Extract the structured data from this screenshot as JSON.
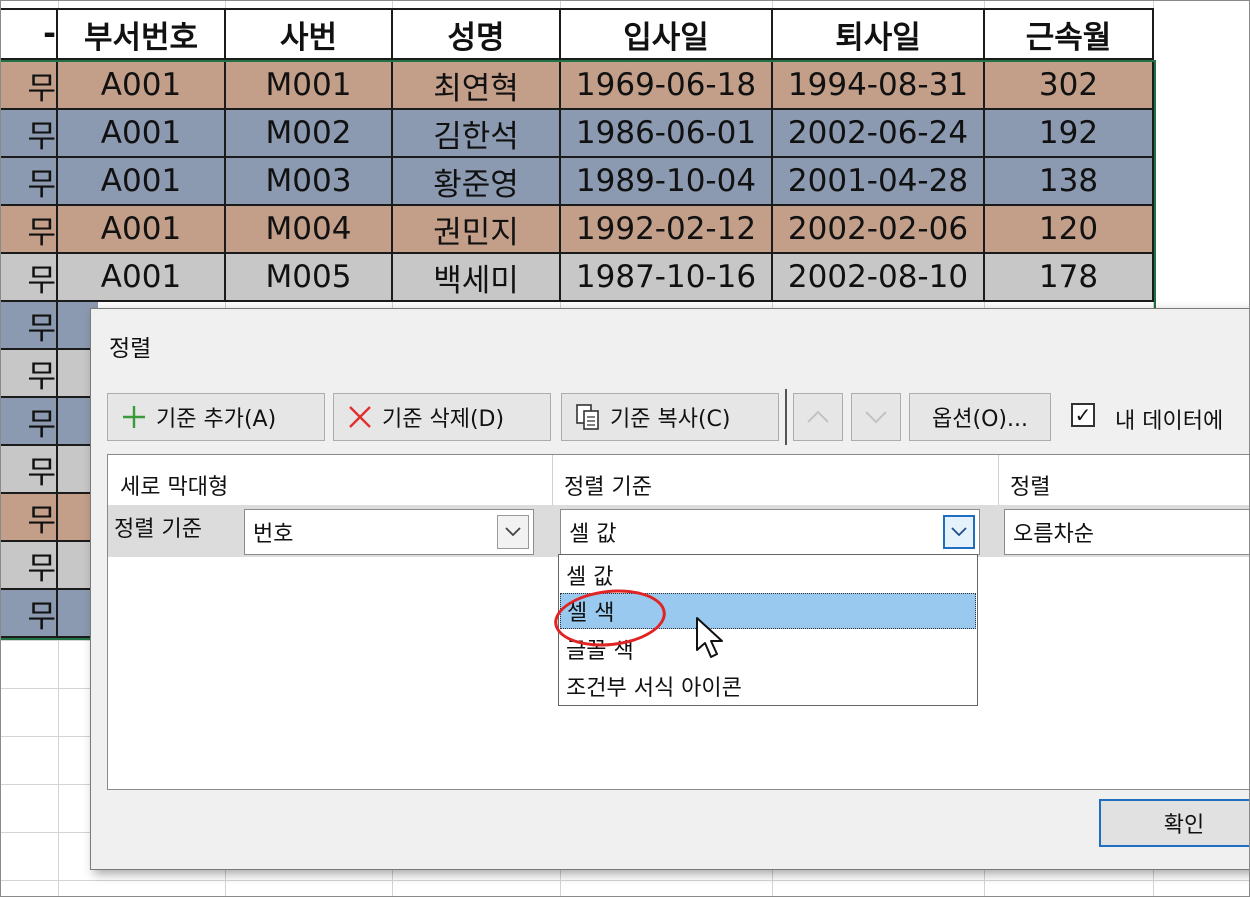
{
  "spreadsheet": {
    "headers": [
      "부서번호",
      "사번",
      "성명",
      "입사일",
      "퇴사일",
      "근속월"
    ],
    "partial_header": "-",
    "partial_cell": "무",
    "rows": [
      {
        "dept": "A001",
        "emp": "M001",
        "name": "최연혁",
        "hire": "1969-06-18",
        "leave": "1994-08-31",
        "months": "302",
        "color": "#c39f8a"
      },
      {
        "dept": "A001",
        "emp": "M002",
        "name": "김한석",
        "hire": "1986-06-01",
        "leave": "2002-06-24",
        "months": "192",
        "color": "#8b9ab1"
      },
      {
        "dept": "A001",
        "emp": "M003",
        "name": "황준영",
        "hire": "1989-10-04",
        "leave": "2001-04-28",
        "months": "138",
        "color": "#8b9ab1"
      },
      {
        "dept": "A001",
        "emp": "M004",
        "name": "권민지",
        "hire": "1992-02-12",
        "leave": "2002-02-06",
        "months": "120",
        "color": "#c39f8a"
      },
      {
        "dept": "A001",
        "emp": "M005",
        "name": "백세미",
        "hire": "1987-10-16",
        "leave": "2002-08-10",
        "months": "178",
        "color": "#c7c7c7"
      }
    ],
    "left_column_colors": [
      "#8b9ab1",
      "#c7c7c7",
      "#8b9ab1",
      "#c7c7c7",
      "#c39f8a",
      "#c7c7c7",
      "#8b9ab1"
    ]
  },
  "dialog": {
    "title": "정렬",
    "toolbar": {
      "add_level": "기준 추가(A)",
      "delete_level": "기준 삭제(D)",
      "copy_level": "기준 복사(C)",
      "options": "옵션(O)...",
      "has_headers": "내 데이터에"
    },
    "grid": {
      "col_column": "세로 막대형",
      "col_sort_on": "정렬 기준",
      "col_order": "정렬",
      "row_label": "정렬 기준",
      "column_value": "번호",
      "sort_on_value": "셀 값",
      "order_value": "오름차순"
    },
    "dropdown_options": [
      "셀 값",
      "셀 색",
      "글꼴 색",
      "조건부 서식 아이콘"
    ],
    "ok_label": "확인"
  },
  "colors": {
    "tan": "#c39f8a",
    "slate": "#8b9ab1",
    "gray": "#c7c7c7",
    "highlight": "#99c9ef",
    "accent": "#1f6fc0",
    "annotation": "#e02424"
  }
}
